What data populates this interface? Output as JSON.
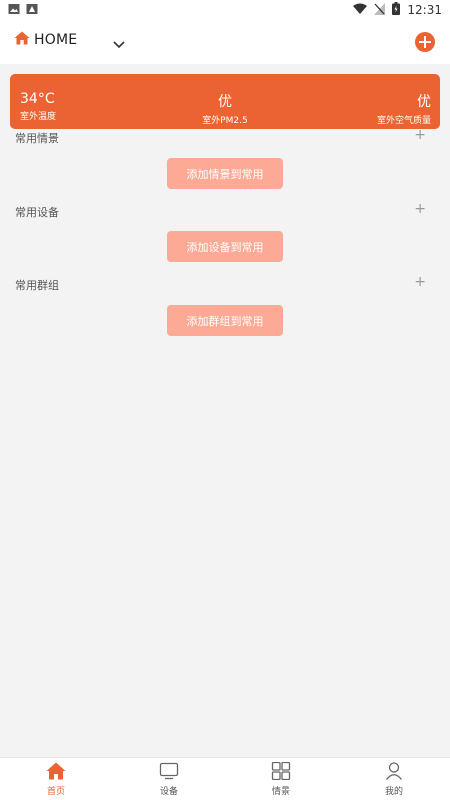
{
  "status_bar": {
    "time": "12:31"
  },
  "header": {
    "home_label": "HOME"
  },
  "weather": {
    "temperature": "34°C",
    "temperature_label": "室外温度",
    "pm25_value": "优",
    "pm25_label": "室外PM2.5",
    "air_value": "优",
    "air_label": "室外空气质量"
  },
  "sections": {
    "scenes": {
      "title": "常用情景",
      "plus": "+",
      "button": "添加情景到常用"
    },
    "devices": {
      "title": "常用设备",
      "plus": "+",
      "button": "添加设备到常用"
    },
    "groups": {
      "title": "常用群组",
      "plus": "+",
      "button": "添加群组到常用"
    }
  },
  "tabs": {
    "home": {
      "label": "首页",
      "icon": "home-icon"
    },
    "devices": {
      "label": "设备",
      "icon": "monitor-icon"
    },
    "scenes": {
      "label": "情景",
      "icon": "grid-icon"
    },
    "mine": {
      "label": "我的",
      "icon": "user-icon"
    }
  },
  "colors": {
    "accent": "#eb6333",
    "button": "#fcaa95",
    "background": "#f3f3f3"
  }
}
